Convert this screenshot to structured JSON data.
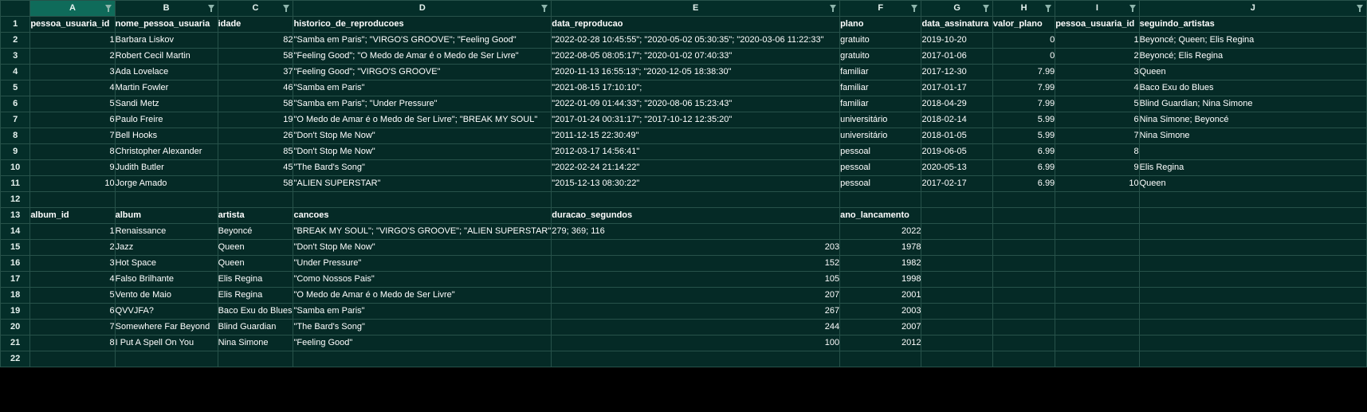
{
  "sheet": {
    "columns": [
      "A",
      "B",
      "C",
      "D",
      "E",
      "F",
      "G",
      "H",
      "I",
      "J"
    ],
    "rows": [
      [
        "pessoa_usuaria_id",
        "nome_pessoa_usuaria",
        "idade",
        "historico_de_reproducoes",
        "data_reproducao",
        "plano",
        "data_assinatura",
        "valor_plano",
        "pessoa_usuaria_id",
        "seguindo_artistas"
      ],
      [
        "1",
        "Barbara Liskov",
        "82",
        "\"Samba em Paris\"; \"VIRGO'S GROOVE\"; \"Feeling Good\"",
        "\"2022-02-28 10:45:55\"; \"2020-05-02 05:30:35\"; \"2020-03-06 11:22:33\"",
        "gratuito",
        "2019-10-20",
        "0",
        "1",
        "Beyoncé; Queen; Elis Regina"
      ],
      [
        "2",
        "Robert Cecil Martin",
        "58",
        "\"Feeling Good\"; \"O Medo de Amar é o Medo de Ser Livre\"",
        "\"2022-08-05 08:05:17\"; \"2020-01-02 07:40:33\"",
        "gratuito",
        "2017-01-06",
        "0",
        "2",
        "Beyoncé; Elis Regina"
      ],
      [
        "3",
        "Ada Lovelace",
        "37",
        "\"Feeling Good\"; \"VIRGO'S GROOVE\"",
        "\"2020-11-13 16:55:13\"; \"2020-12-05 18:38:30\"",
        "familiar",
        "2017-12-30",
        "7.99",
        "3",
        "Queen"
      ],
      [
        "4",
        "Martin Fowler",
        "46",
        "\"Samba em Paris\"",
        "\"2021-08-15 17:10:10\";",
        "familiar",
        "2017-01-17",
        "7.99",
        "4",
        "Baco Exu do Blues"
      ],
      [
        "5",
        "Sandi Metz",
        "58",
        "\"Samba em Paris\"; \"Under Pressure\"",
        "\"2022-01-09 01:44:33\"; \"2020-08-06 15:23:43\"",
        "familiar",
        "2018-04-29",
        "7.99",
        "5",
        "Blind Guardian; Nina Simone"
      ],
      [
        "6",
        "Paulo Freire",
        "19",
        "\"O Medo de Amar é o Medo de Ser Livre\"; \"BREAK MY SOUL\"",
        "\"2017-01-24 00:31:17\"; \"2017-10-12 12:35:20\"",
        "universitário",
        "2018-02-14",
        "5.99",
        "6",
        "Nina Simone; Beyoncé"
      ],
      [
        "7",
        "Bell Hooks",
        "26",
        "\"Don't Stop Me Now\"",
        "\"2011-12-15 22:30:49\"",
        "universitário",
        "2018-01-05",
        "5.99",
        "7",
        "Nina Simone"
      ],
      [
        "8",
        "Christopher Alexander",
        "85",
        "\"Don't Stop Me Now\"",
        "\"2012-03-17 14:56:41\"",
        "pessoal",
        "2019-06-05",
        "6.99",
        "8",
        ""
      ],
      [
        "9",
        "Judith Butler",
        "45",
        "\"The Bard's Song\"",
        "\"2022-02-24 21:14:22\"",
        "pessoal",
        "2020-05-13",
        "6.99",
        "9",
        "Elis Regina"
      ],
      [
        "10",
        "Jorge Amado",
        "58",
        "\"ALIEN SUPERSTAR\"",
        "\"2015-12-13 08:30:22\"",
        "pessoal",
        "2017-02-17",
        "6.99",
        "10",
        "Queen"
      ],
      [
        "",
        "",
        "",
        "",
        "",
        "",
        "",
        "",
        "",
        ""
      ],
      [
        "album_id",
        "album",
        "artista",
        "cancoes",
        "duracao_segundos",
        "ano_lancamento",
        "",
        "",
        "",
        ""
      ],
      [
        "1",
        "Renaissance",
        "Beyoncé",
        "\"BREAK MY SOUL\"; \"VIRGO'S GROOVE\"; \"ALIEN SUPERSTAR\"",
        "279; 369; 116",
        "2022",
        "",
        "",
        "",
        ""
      ],
      [
        "2",
        "Jazz",
        "Queen",
        "\"Don't Stop Me Now\"",
        "203",
        "1978",
        "",
        "",
        "",
        ""
      ],
      [
        "3",
        "Hot Space",
        "Queen",
        "\"Under Pressure\"",
        "152",
        "1982",
        "",
        "",
        "",
        ""
      ],
      [
        "4",
        "Falso Brilhante",
        "Elis Regina",
        "\"Como Nossos Pais\"",
        "105",
        "1998",
        "",
        "",
        "",
        ""
      ],
      [
        "5",
        "Vento de Maio",
        "Elis Regina",
        "\"O Medo de Amar é o Medo de Ser Livre\"",
        "207",
        "2001",
        "",
        "",
        "",
        ""
      ],
      [
        "6",
        "QVVJFA?",
        "Baco Exu do Blues",
        "\"Samba em Paris\"",
        "267",
        "2003",
        "",
        "",
        "",
        ""
      ],
      [
        "7",
        "Somewhere Far Beyond",
        "Blind Guardian",
        "\"The Bard's Song\"",
        "244",
        "2007",
        "",
        "",
        "",
        ""
      ],
      [
        "8",
        "I Put A Spell On You",
        "Nina Simone",
        "\"Feeling Good\"",
        "100",
        "2012",
        "",
        "",
        "",
        ""
      ],
      [
        "",
        "",
        "",
        "",
        "",
        "",
        "",
        "",
        "",
        ""
      ]
    ]
  }
}
